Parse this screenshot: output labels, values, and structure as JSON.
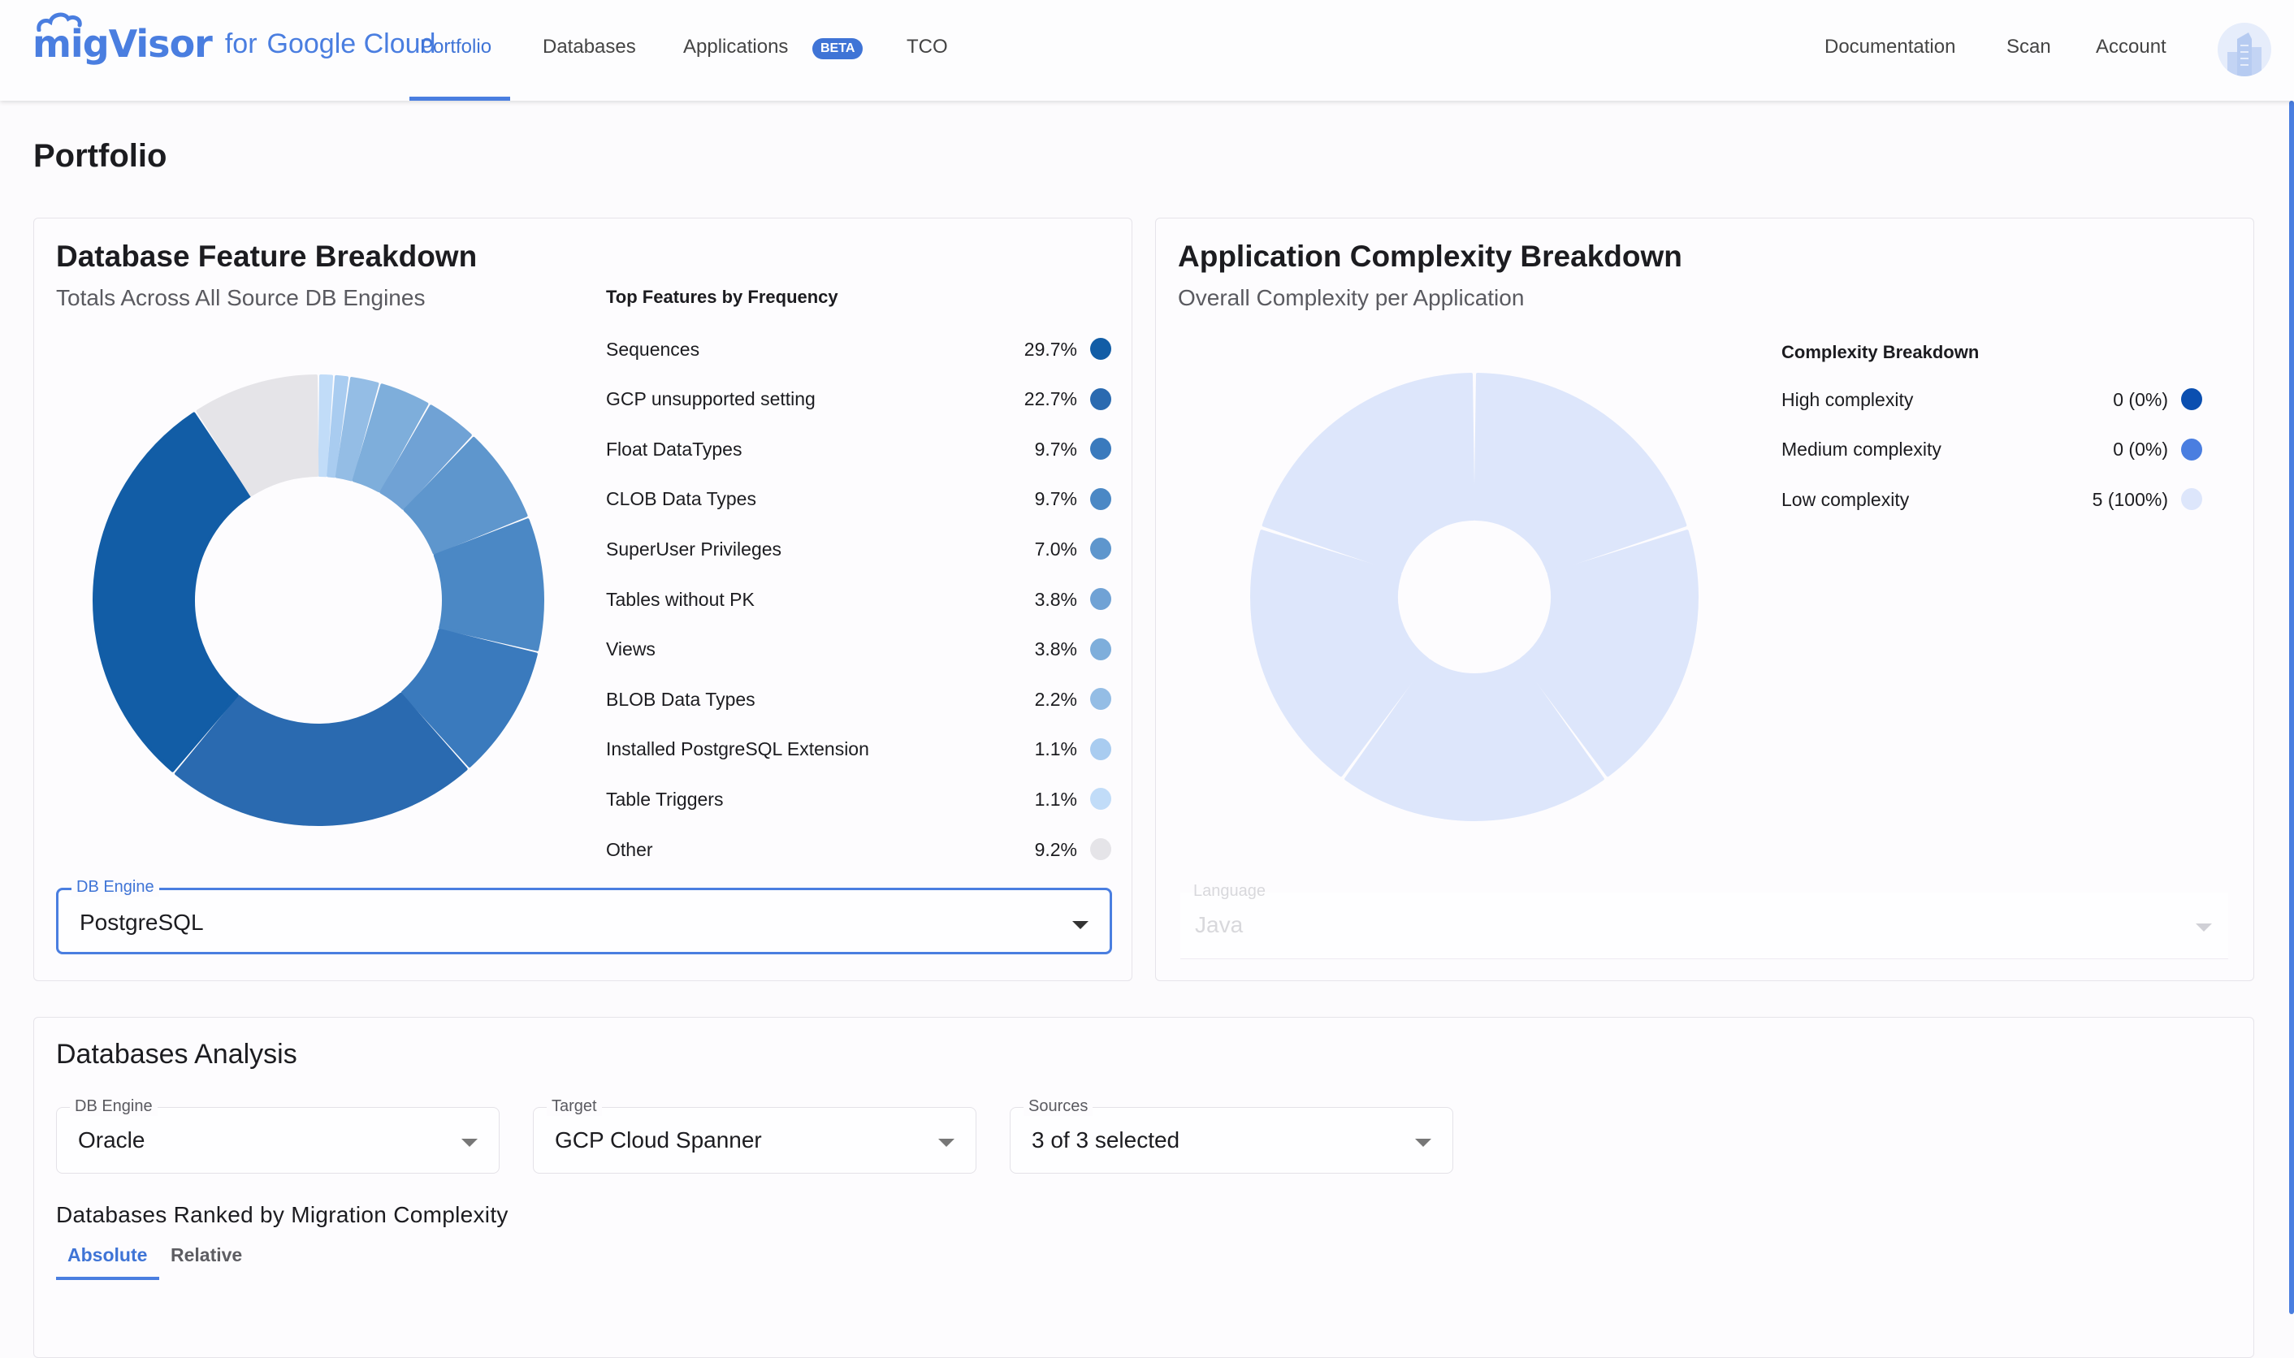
{
  "header": {
    "brand": {
      "mig": "migVisor",
      "for": "for",
      "google": "Google Cloud"
    },
    "nav": [
      {
        "label": "Portfolio",
        "active": true
      },
      {
        "label": "Databases",
        "active": false
      },
      {
        "label": "Applications",
        "active": false,
        "badge": "BETA"
      },
      {
        "label": "TCO",
        "active": false
      }
    ],
    "right_nav": [
      "Documentation",
      "Scan",
      "Account"
    ],
    "avatar_icon": "building-icon"
  },
  "page_title": "Portfolio",
  "feature_card": {
    "title": "Database Feature Breakdown",
    "subtitle": "Totals Across All Source DB Engines",
    "legend_title": "Top Features by Frequency",
    "db_engine_select": {
      "label": "DB Engine",
      "value": "PostgreSQL"
    }
  },
  "complexity_card": {
    "title": "Application Complexity Breakdown",
    "subtitle": "Overall Complexity per Application",
    "legend_title": "Complexity Breakdown",
    "language_select": {
      "label": "Language",
      "value": "Java"
    }
  },
  "db_analysis": {
    "title": "Databases Analysis",
    "selects": [
      {
        "label": "DB Engine",
        "value": "Oracle"
      },
      {
        "label": "Target",
        "value": "GCP Cloud Spanner"
      },
      {
        "label": "Sources",
        "value": "3 of 3 selected"
      }
    ],
    "ranked_title": "Databases Ranked by Migration Complexity",
    "tabs": [
      {
        "label": "Absolute",
        "active": true
      },
      {
        "label": "Relative",
        "active": false
      }
    ]
  },
  "colors": {
    "accent": "#4a7ee0",
    "accent_text": "#3f74d6"
  },
  "chart_data": [
    {
      "type": "pie",
      "variant": "donut",
      "title": "Top Features by Frequency",
      "unit": "%",
      "order": "clockwise from top, smallest first, Other last",
      "categories": [
        "Sequences",
        "GCP unsupported setting",
        "Float DataTypes",
        "CLOB Data Types",
        "SuperUser Privileges",
        "Tables without PK",
        "Views",
        "BLOB Data Types",
        "Installed PostgreSQL Extension",
        "Table Triggers",
        "Other"
      ],
      "values": [
        29.7,
        22.7,
        9.7,
        9.7,
        7.0,
        3.8,
        3.8,
        2.2,
        1.1,
        1.1,
        9.2
      ],
      "labels": [
        "29.7%",
        "22.7%",
        "9.7%",
        "9.7%",
        "7.0%",
        "3.8%",
        "3.8%",
        "2.2%",
        "1.1%",
        "1.1%",
        "9.2%"
      ],
      "colors": [
        "#125da6",
        "#2a6ab0",
        "#3a7abd",
        "#4b88c5",
        "#5e96cd",
        "#70a2d5",
        "#7eaedb",
        "#94bde5",
        "#a9ccf0",
        "#c1dcf8",
        "#e5e4e8"
      ],
      "legend": "right"
    },
    {
      "type": "pie",
      "variant": "donut",
      "title": "Complexity Breakdown",
      "categories": [
        "High complexity",
        "Medium complexity",
        "Low complexity"
      ],
      "values": [
        0,
        0,
        5
      ],
      "labels": [
        "0 (0%)",
        "0 (0%)",
        "5 (100%)"
      ],
      "colors": [
        "#0b4fb0",
        "#4a7ee0",
        "#dde6fb"
      ],
      "application_count": 5,
      "legend": "right"
    }
  ]
}
